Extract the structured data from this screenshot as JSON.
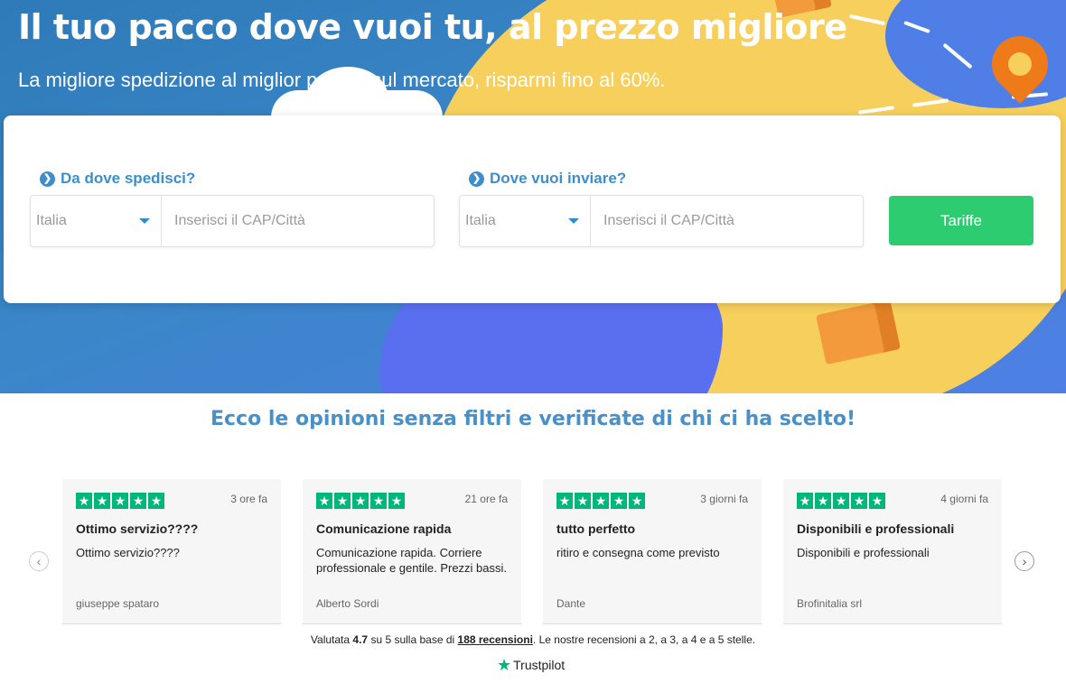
{
  "hero": {
    "title": "Il tuo pacco dove vuoi tu, al prezzo migliore",
    "subtitle": "La migliore spedizione al miglior prezzo sul mercato, risparmi fino al 60%."
  },
  "search": {
    "from_label": "Da dove spedisci?",
    "to_label": "Dove vuoi inviare?",
    "from_country": "Italia",
    "to_country": "Italia",
    "from_placeholder": "Inserisci il CAP/Città",
    "to_placeholder": "Inserisci il CAP/Città",
    "submit_label": "Tariffe"
  },
  "reviews": {
    "heading": "Ecco le opinioni senza filtri e verificate di chi ci ha scelto!",
    "items": [
      {
        "time": "3 ore fa",
        "title": "Ottimo servizio????",
        "text": "Ottimo servizio????",
        "author": "giuseppe spataro"
      },
      {
        "time": "21 ore fa",
        "title": "Comunicazione rapida",
        "text": "Comunicazione rapida. Corriere professionale e gentile. Prezzi bassi.",
        "author": "Alberto Sordi"
      },
      {
        "time": "3 giorni fa",
        "title": "tutto perfetto",
        "text": "ritiro e consegna come previsto",
        "author": "Dante"
      },
      {
        "time": "4 giorni fa",
        "title": "Disponibili e professionali",
        "text": "Disponibili e professionali",
        "author": "Brofinitalia srl"
      }
    ],
    "stars": 5,
    "summary_prefix": "Valutata",
    "rating": "4.7",
    "summary_mid": "su 5 sulla base di",
    "review_count_link": "188 recensioni",
    "summary_suffix": ". Le nostre recensioni a 2, a 3, a 4 e a 5 stelle.",
    "brand": "Trustpilot"
  },
  "colors": {
    "accent": "#3f8ec9",
    "button": "#2ecc71",
    "trustpilot": "#00b67a"
  }
}
